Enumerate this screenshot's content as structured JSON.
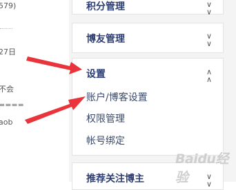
{
  "left_fragments": [
    "579)",
    "27日",
    "不会",
    "====",
    "aob"
  ],
  "sidebar": {
    "points_title": "积分管理",
    "friends_title": "博友管理",
    "settings": {
      "title": "设置",
      "items": [
        "账户/博客设置",
        "权限管理",
        "帐号绑定"
      ]
    },
    "recommend_title": "推荐关注博主"
  },
  "watermark": "Baidu经验",
  "colors": {
    "title": "#2d3e74",
    "sub": "#3b4a6a",
    "arrow": "#e8343a"
  }
}
